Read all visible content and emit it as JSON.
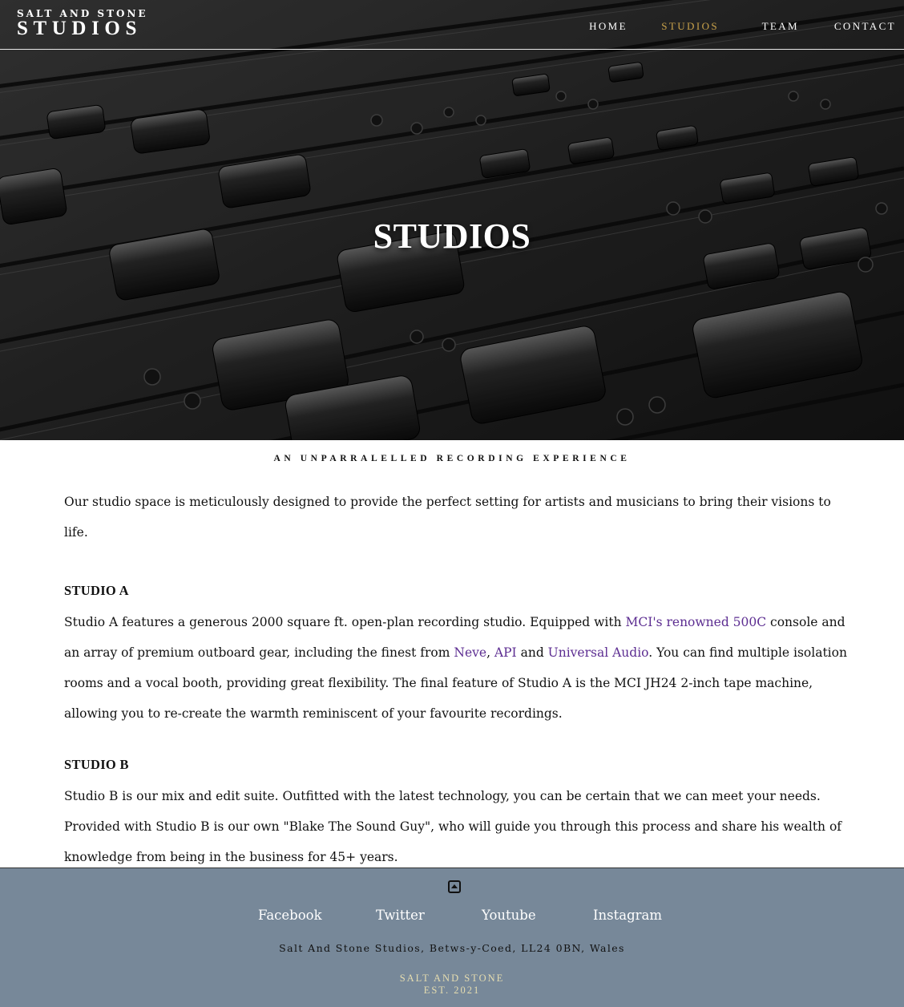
{
  "brand": {
    "small": "SALT AND STONE",
    "big": "STUDIOS"
  },
  "nav": {
    "items": [
      {
        "label": "HOME",
        "active": false
      },
      {
        "label": "STUDIOS",
        "active": true
      },
      {
        "label": "TEAM",
        "active": false
      },
      {
        "label": "CONTACT",
        "active": false
      }
    ],
    "active_color": "#c9a24a"
  },
  "hero": {
    "title": "STUDIOS",
    "image": "mixing-console-faders"
  },
  "main": {
    "tagline": "AN UNPARRALELLED RECORDING EXPERIENCE",
    "intro": "Our studio space is meticulously designed to provide the perfect setting for artists and musicians to bring their visions to life.",
    "studio_a": {
      "heading": "STUDIO A",
      "text_1": "Studio A features a generous 2000 square ft. open-plan recording studio. Equipped with ",
      "link_mci": "MCI's renowned 500C",
      "text_2": " console and an array of premium outboard gear, including the finest from ",
      "link_neve": "Neve",
      "text_3": ", ",
      "link_api": "API",
      "text_4": " and ",
      "link_ua": "Universal Audio",
      "text_5": ". You can find multiple isolation rooms and a vocal booth, providing great flexibility. The final feature of Studio A is the MCI JH24 2-inch tape machine, allowing you to re-create the warmth reminiscent of your favourite recordings."
    },
    "studio_b": {
      "heading": "STUDIO B",
      "text": "Studio B is our mix and edit suite. Outfitted with the latest technology, you can be certain that we can meet your needs. Provided with Studio B is our own \"Blake The Sound Guy\", who will guide you through this process and share his wealth of knowledge from being in the business for 45+ years."
    },
    "link_color": "#5c2d91"
  },
  "footer": {
    "back_to_top_icon": "arrow-up-square-icon",
    "social": [
      "Facebook",
      "Twitter",
      "Youtube",
      "Instagram"
    ],
    "address": "Salt And Stone Studios, Betws-y-Coed, LL24 0BN, Wales",
    "est_line1": "SALT AND STONE",
    "est_line2": "EST. 2021",
    "background": "#778899"
  }
}
